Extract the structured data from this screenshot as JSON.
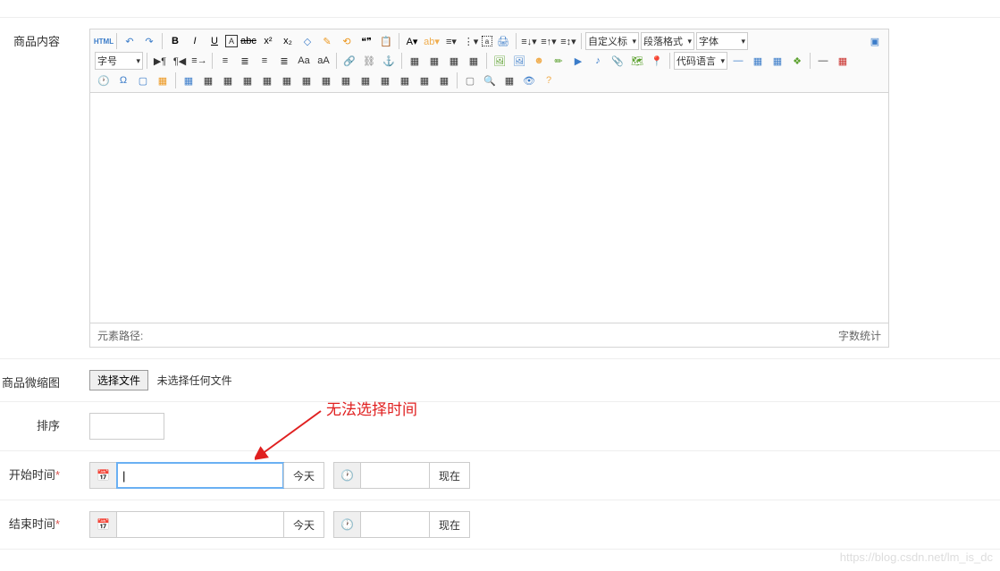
{
  "labels": {
    "content": "商品内容",
    "thumb": "商品微缩图",
    "sort": "排序",
    "start": "开始时间",
    "end": "结束时间"
  },
  "editor": {
    "html": "HTML",
    "select_custom": "自定义标",
    "select_para": "段落格式",
    "select_font": "字体",
    "select_size": "字号",
    "select_code": "代码语言",
    "path_label": "元素路径:",
    "wordcount": "字数统计"
  },
  "file": {
    "button": "选择文件",
    "none": "未选择任何文件"
  },
  "dt": {
    "today": "今天",
    "now": "现在"
  },
  "annotation": "无法选择时间",
  "watermark": "https://blog.csdn.net/lm_is_dc"
}
